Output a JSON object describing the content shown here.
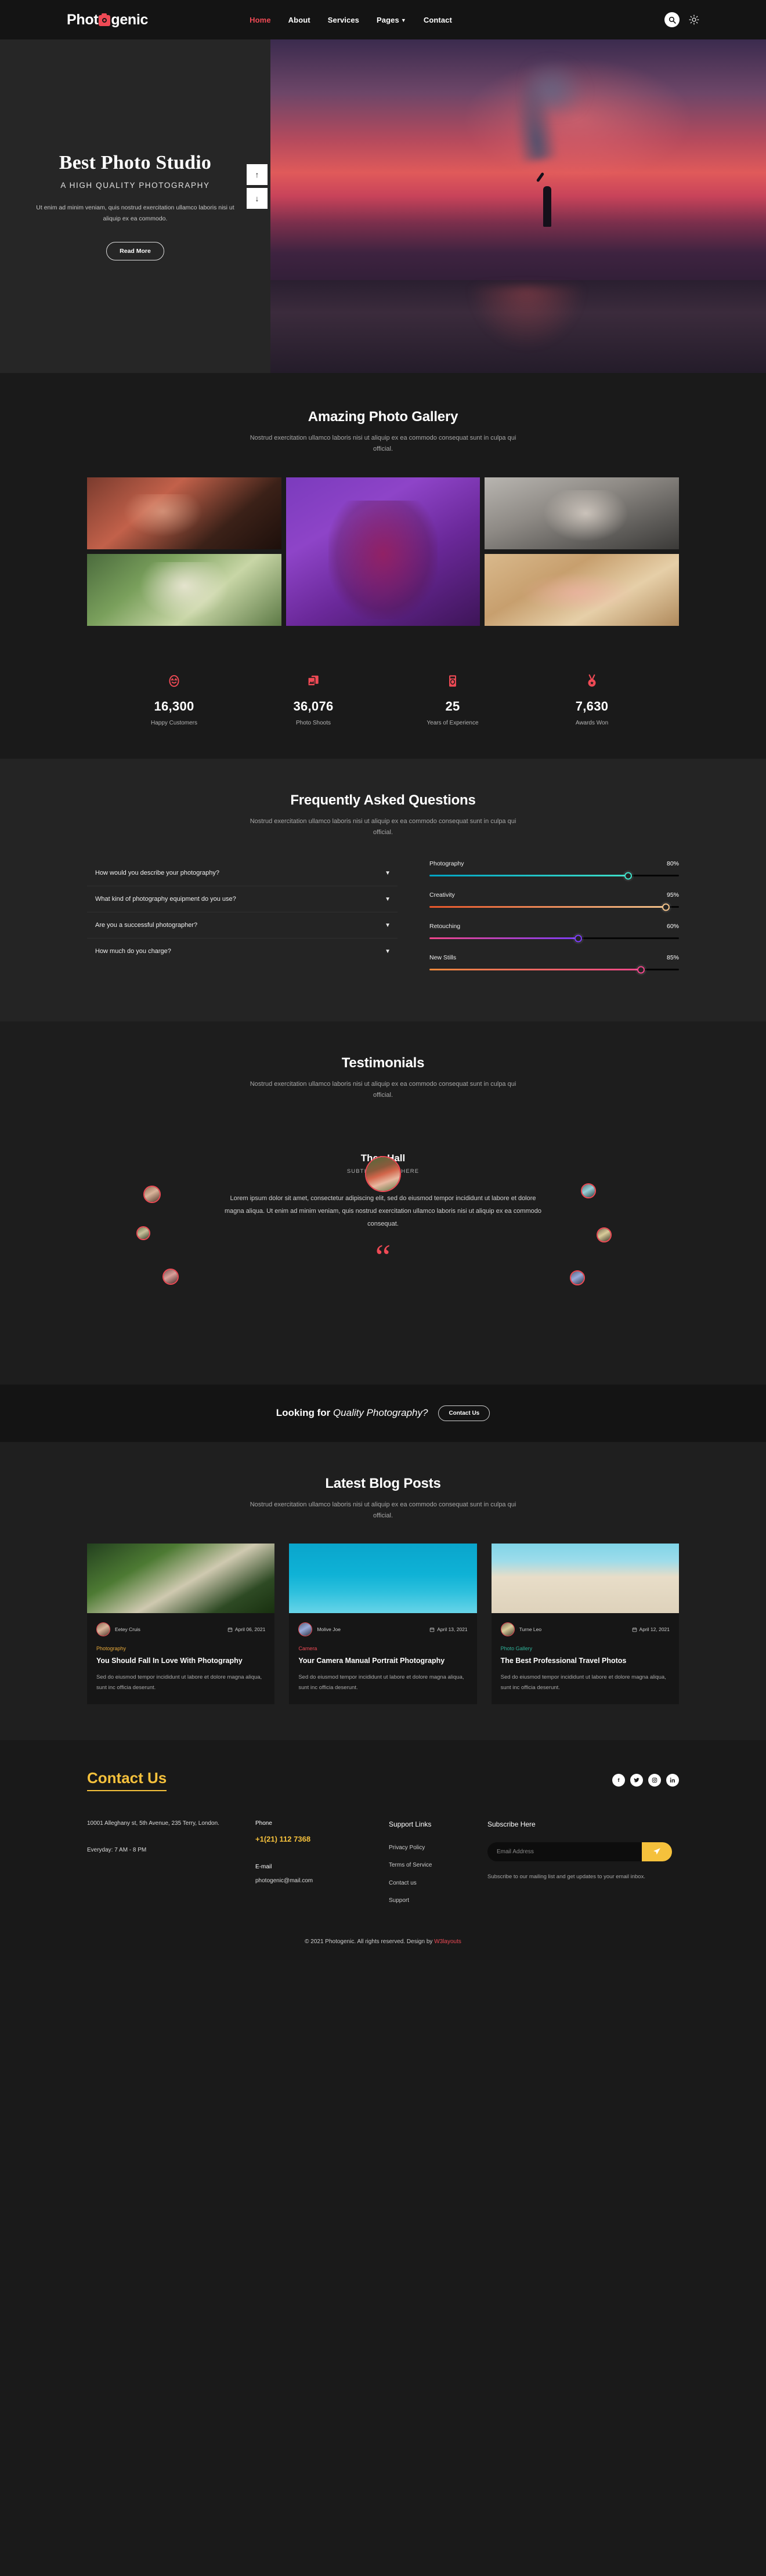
{
  "header": {
    "logo_text_1": "Phot",
    "logo_text_2": "genic",
    "nav": [
      {
        "label": "Home",
        "active": true
      },
      {
        "label": "About",
        "active": false
      },
      {
        "label": "Services",
        "active": false
      },
      {
        "label": "Pages",
        "active": false,
        "has_dropdown": true
      },
      {
        "label": "Contact",
        "active": false
      }
    ],
    "search_icon": "search-icon",
    "theme_icon": "sun-icon"
  },
  "hero": {
    "title": "Best Photo Studio",
    "subtitle": "A HIGH QUALITY PHOTOGRAPHY",
    "text": "Ut enim ad minim veniam, quis nostrud exercitation ullamco laboris nisi ut aliquip ex ea commodo.",
    "button": "Read More",
    "arrow_up": "↑",
    "arrow_down": "↓"
  },
  "gallery": {
    "title": "Amazing Photo Gallery",
    "subtitle": "Nostrud exercitation ullamco laboris nisi ut aliquip ex ea commodo consequat sunt in culpa qui official."
  },
  "stats": [
    {
      "icon": "smiley-icon",
      "number": "16,300",
      "label": "Happy Customers"
    },
    {
      "icon": "photos-icon",
      "number": "36,076",
      "label": "Photo Shoots"
    },
    {
      "icon": "camera-icon",
      "number": "25",
      "label": "Years of Experience"
    },
    {
      "icon": "medal-icon",
      "number": "7,630",
      "label": "Awards Won"
    }
  ],
  "faq": {
    "title": "Frequently Asked Questions",
    "subtitle": "Nostrud exercitation ullamco laboris nisi ut aliquip ex ea commodo consequat sunt in culpa qui official.",
    "questions": [
      "How would you describe your photography?",
      "What kind of photography equipment do you use?",
      "Are you a successful photographer?",
      "How much do you charge?"
    ]
  },
  "chart_data": {
    "type": "bar",
    "title": "Skills",
    "categories": [
      "Photography",
      "Creativity",
      "Retouching",
      "New Stills"
    ],
    "values": [
      80,
      95,
      60,
      85
    ],
    "value_labels": [
      "80%",
      "95%",
      "60%",
      "85%"
    ],
    "xlabel": "",
    "ylabel": "",
    "ylim": [
      0,
      100
    ],
    "grid": false,
    "legend": "none",
    "orientation": "horizontal",
    "colors": [
      "#00a3c4",
      "#e8562a",
      "#f0468a",
      "#f08a3c"
    ]
  },
  "testimonials": {
    "title": "Testimonials",
    "subtitle": "Nostrud exercitation ullamco laboris nisi ut aliquip ex ea commodo consequat sunt in culpa qui official.",
    "name": "Theo Hall",
    "role": "SUBTITLE GOES HERE",
    "quote": "Lorem ipsum dolor sit amet, consectetur adipiscing elit, sed do eiusmod tempor incididunt ut labore et dolore magna aliqua. Ut enim ad minim veniam, quis nostrud exercitation ullamco laboris nisi ut aliquip ex ea commodo consequat.",
    "quote_mark": "“"
  },
  "cta": {
    "text_bold": "Looking for ",
    "text_italic": "Quality Photography?",
    "button": "Contact Us"
  },
  "blog": {
    "title": "Latest Blog Posts",
    "subtitle": "Nostrud exercitation ullamco laboris nisi ut aliquip ex ea commodo consequat sunt in culpa qui official.",
    "posts": [
      {
        "author": "Eetey Cruis",
        "date": "April 06, 2021",
        "category": "Photography",
        "title": "You Should Fall In Love With Photography",
        "excerpt": "Sed do eiusmod tempor incididunt ut labore et dolore magna aliqua, sunt inc officia deserunt."
      },
      {
        "author": "Molive Joe",
        "date": "April 13, 2021",
        "category": "Camera",
        "title": "Your Camera Manual Portrait Photography",
        "excerpt": "Sed do eiusmod tempor incididunt ut labore et dolore magna aliqua, sunt inc officia deserunt."
      },
      {
        "author": "Turne Leo",
        "date": "April 12, 2021",
        "category": "Photo Gallery",
        "title": "The Best Professional Travel Photos",
        "excerpt": "Sed do eiusmod tempor incididunt ut labore et dolore magna aliqua, sunt inc officia deserunt."
      }
    ]
  },
  "footer": {
    "heading": "Contact Us",
    "socials": [
      "facebook-icon",
      "twitter-icon",
      "instagram-icon",
      "linkedin-icon"
    ],
    "address": "10001 Alleghany st, 5th Avenue, 235 Terry, London.",
    "hours": "Everyday: 7 AM - 8 PM",
    "phone_label": "Phone",
    "phone": "+1(21) 112 7368",
    "email_label": "E-mail",
    "email": "photogenic@mail.com",
    "support_title": "Support Links",
    "support_links": [
      "Privacy Policy",
      "Terms of Service",
      "Contact us",
      "Support"
    ],
    "subscribe_title": "Subscribe Here",
    "subscribe_placeholder": "Email Address",
    "subscribe_value": "",
    "subscribe_note": "Subscribe to our mailing list and get updates to your email inbox.",
    "copyright": "© 2021 Photogenic. All rights reserved. Design by ",
    "designer": "W3layouts"
  }
}
